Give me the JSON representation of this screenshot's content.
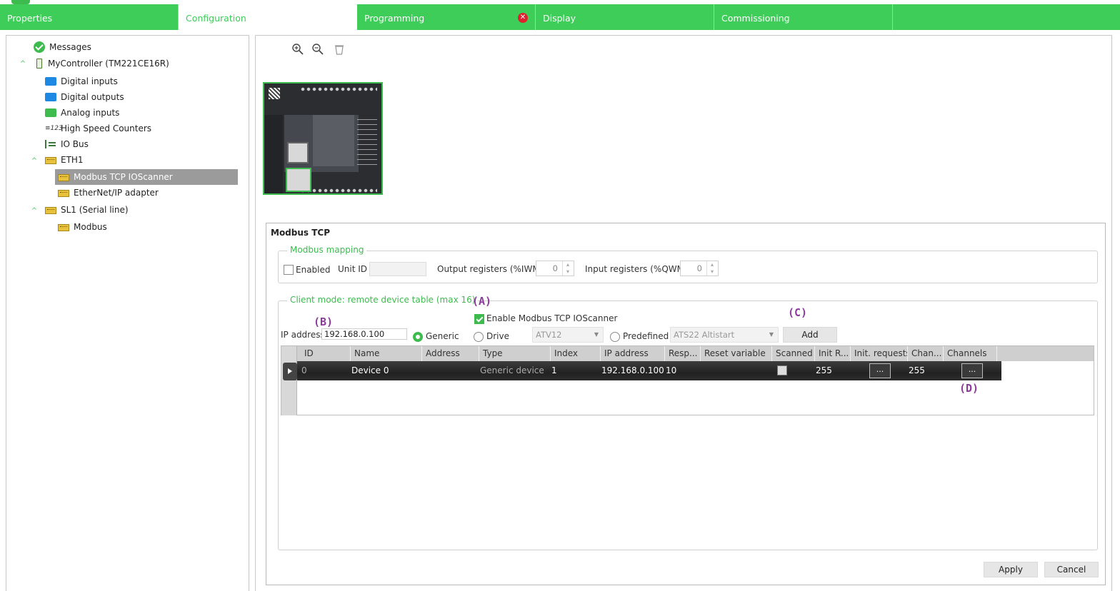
{
  "nav": {
    "tabs": [
      {
        "label": "Properties"
      },
      {
        "label": "Configuration"
      },
      {
        "label": "Programming",
        "error_icon": "✕"
      },
      {
        "label": "Display"
      },
      {
        "label": "Commissioning"
      }
    ]
  },
  "tree": {
    "messages": "Messages",
    "controller": "MyController (TM221CE16R)",
    "digital_inputs": "Digital inputs",
    "digital_outputs": "Digital outputs",
    "analog_inputs": "Analog inputs",
    "hsc_icon_text": "≡123",
    "hsc": "High Speed Counters",
    "io_bus": "IO Bus",
    "eth1": "ETH1",
    "modbus_tcp_ioscanner": "Modbus TCP IOScanner",
    "ethernet_ip": "EtherNet/IP adapter",
    "sl1": "SL1 (Serial line)",
    "modbus": "Modbus",
    "caret_symbol": "^"
  },
  "toolbar": {
    "zoom_in_icon": "zoom-in-icon",
    "zoom_out_icon": "zoom-out-icon",
    "delete_icon": "trash-icon"
  },
  "panel": {
    "title": "Modbus TCP",
    "mapping": {
      "title": "Modbus mapping",
      "enabled_label": "Enabled",
      "unit_id_label": "Unit ID",
      "unit_id_value": "",
      "output_registers_label": "Output registers (%IWM)",
      "output_registers_value": "0",
      "input_registers_label": "Input registers (%QWM)",
      "input_registers_value": "0"
    },
    "client": {
      "title": "Client mode: remote device table (max 16)",
      "enable_label": "Enable Modbus TCP IOScanner",
      "ip_label": "IP address",
      "ip_value": "192.168.0.100",
      "generic_label": "Generic",
      "drive_label": "Drive",
      "drive_select": "ATV12",
      "predefined_label": "Predefined",
      "predefined_select": "ATS22 Altistart",
      "add_button": "Add"
    },
    "table": {
      "columns": [
        "ID",
        "Name",
        "Address",
        "Type",
        "Index",
        "IP address",
        "Resp...",
        "Reset variable",
        "Scanned",
        "Init R...",
        "Init. requests",
        "Chan...",
        "Channels"
      ],
      "rows": [
        {
          "id": "0",
          "name": "Device 0",
          "address": "",
          "type": "Generic device",
          "index": "1",
          "ip": "192.168.0.100",
          "resp": "10",
          "reset_var": "",
          "init_r": "255",
          "init_req_btn": "...",
          "chan": "255",
          "channels_btn": "..."
        }
      ]
    },
    "apply_button": "Apply",
    "cancel_button": "Cancel"
  },
  "annotations": {
    "a": "(A)",
    "b": "(B)",
    "c": "(C)",
    "d": "(D)"
  },
  "colors": {
    "brand_green": "#3dcd58",
    "annotation_purple": "#8e3b9e",
    "error_red": "#e0202e"
  }
}
